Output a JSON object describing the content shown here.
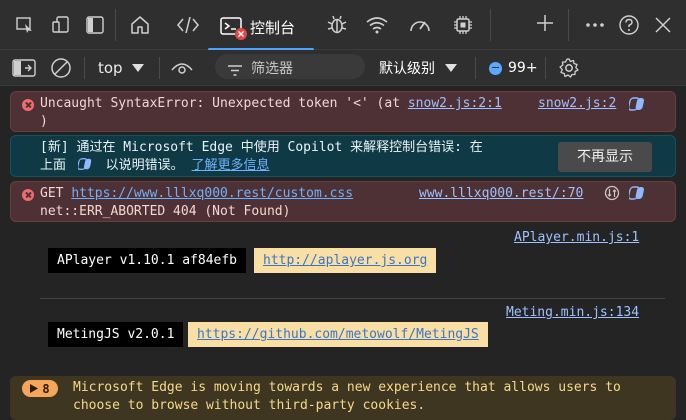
{
  "tabs": {
    "console_label": "控制台",
    "accent": "#4aa3ff"
  },
  "toolbar": {
    "context": "top",
    "filter_placeholder": "筛选器",
    "level": "默认级别",
    "issues_count": "99+"
  },
  "messages": {
    "error1": {
      "text": "Uncaught SyntaxError: Unexpected token '<' (at",
      "inline_link": "snow2.js:2:1",
      "close": ")",
      "source": "snow2.js:2"
    },
    "copilot": {
      "line1": "[新] 通过在 Microsoft Edge 中使用 Copilot 来解释控制台错误: 在",
      "line2_prefix": "上面",
      "line2_middle": "以说明错误。",
      "learn_more": "了解更多信息",
      "dismiss": "不再显示"
    },
    "error2": {
      "get": "GET",
      "url": "https://www.lllxq000.rest/custom.css",
      "source": "www.lllxq000.rest/:70",
      "status": "net::ERR_ABORTED 404 (Not Found)"
    },
    "aplayer": {
      "source": "APlayer.min.js:1",
      "badge": "APlayer v1.10.1 af84efb",
      "link": "http://aplayer.js.org"
    },
    "meting": {
      "source": "Meting.min.js:134",
      "badge": "MetingJS v2.0.1",
      "link": "https://github.com/metowolf/MetingJS"
    },
    "warning": {
      "count": "8",
      "line1": "Microsoft Edge is moving towards a new experience that allows users to",
      "line2": "choose to browse without third-party cookies."
    }
  },
  "colors": {
    "error_bg": "#4e3134",
    "info_bg": "#0f3a45",
    "warn_bg": "#3f3621",
    "warn_text": "#f5d98a",
    "link": "#6fb1ff"
  }
}
